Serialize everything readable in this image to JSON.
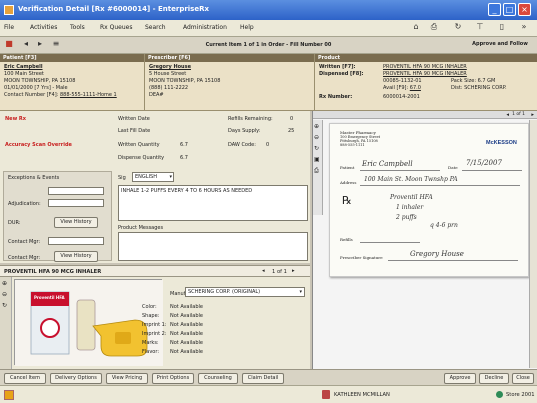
{
  "window": {
    "title": "Verification Detail [Rx #6000014] - EnterpriseRx"
  },
  "menu": [
    "File",
    "Activities",
    "Tools",
    "Rx Queues",
    "Search",
    "Administration",
    "Help"
  ],
  "navbar": {
    "current_item": "Current Item 1 of 1 in Order - Fill Number 00",
    "approve_label": "Approve and Follow"
  },
  "patient": {
    "title": "Patient [F3]",
    "name": "Eric Campbell",
    "address1": "100 Main Street",
    "address2": "MOON TOWNSHIP, PA 15108",
    "dob_line": "01/01/2000 [7 Yrs] - Male",
    "contact_label": "Contact Number [F4]:",
    "contact_value": "888-555-1111-Home 1"
  },
  "prescriber": {
    "title": "Prescriber [F6]",
    "name": "Gregory House",
    "address1": "5 House Street",
    "address2": "MOON TOWNSHIP, PA 15108",
    "phone": "(888) 111-2222",
    "dea": "DEA#"
  },
  "product": {
    "title": "Product",
    "written_label": "Written [F7]:",
    "written_value": "PROVENTIL HFA 90 MCG INHALER",
    "dispensed_label": "Dispensed [F8]:",
    "dispensed_value": "PROVENTIL HFA 90 MCG INHALER",
    "ndc": "00085-1132-01",
    "pack_size": "Pack Size: 6.7 GM",
    "avail_label": "Avail [F9]:",
    "avail_value": "67.0",
    "dist": "Dist: SCHERING CORP.",
    "rx_number_label": "Rx Number:",
    "rx_number_value": "6000014-2001"
  },
  "fill": {
    "new_rx": "New Rx",
    "accuracy_scan": "Accuracy Scan Override",
    "written_date_label": "Written Date",
    "last_fill_label": "Last Fill Date",
    "written_qty_label": "Written Quantity",
    "written_qty_value": "6.7",
    "dispense_qty_label": "Dispense Quantity",
    "dispense_qty_value": "6.7",
    "refills_label": "Refills Remaining:",
    "refills_value": "0",
    "days_supply_label": "Days Supply:",
    "days_supply_value": "25",
    "daw_label": "DAW Code:",
    "daw_value": "0"
  },
  "exceptions": {
    "title": "Exceptions & Events",
    "adjudication": "Adjudication:",
    "dur": "DUR:",
    "view_history": "View History",
    "contact_mgr": "Contact Mgr:"
  },
  "sig": {
    "label": "Sig",
    "language": "ENGLISH",
    "text": "INHALE 1-2 PUFFS EVERY 4 TO 6 HOURS AS NEEDED"
  },
  "product_messages": {
    "title": "Product Messages"
  },
  "image_viewer": {
    "page": "1 of 1"
  },
  "scan": {
    "pharmacy": "Master Pharmacy",
    "pharmacy_addr1": "100 Emergency Street",
    "pharmacy_addr2": "Pittsburgh, PA 15108",
    "pharmacy_phone": "888-555-1111",
    "logo": "McKESSON",
    "patient_label": "Patient",
    "patient_hw": "Eric Campbell",
    "date_label": "Date",
    "date_hw": "7/15/2007",
    "address_label": "Address",
    "address_hw": "100 Main St. Moon Twnshp PA",
    "rx_symbol": "℞",
    "rx_line1": "Proventil HFA",
    "rx_line2": "1 inhaler",
    "rx_line3": "2 puffs",
    "rx_line4": "q 4-6 prn",
    "refills_label": "Refills",
    "prescriber_label": "Prescriber Signature",
    "prescriber_hw": "Gregory House"
  },
  "drug_panel": {
    "title": "PROVENTIL HFA 90 MCG INHALER",
    "page": "1 of 1",
    "manufacturer_label": "Manufacturer:",
    "manufacturer_value": "SCHERING CORP. (ORIGINAL)",
    "rows": [
      {
        "label": "Color:",
        "value": "Not Available"
      },
      {
        "label": "Shape:",
        "value": "Not Available"
      },
      {
        "label": "Imprint 1:",
        "value": "Not Available"
      },
      {
        "label": "Imprint 2:",
        "value": "Not Available"
      },
      {
        "label": "Marks:",
        "value": "Not Available"
      },
      {
        "label": "Flavor:",
        "value": "Not Available"
      }
    ],
    "box_brand": "Proventil HFA"
  },
  "bottom_buttons": [
    "Cancel Item",
    "Delivery Options",
    "View Pricing",
    "Print Options",
    "Counseling",
    "Claim Detail"
  ],
  "right_buttons": [
    "Approve",
    "Decline",
    "Close"
  ],
  "status": {
    "user": "KATHLEEN MCMILLAN",
    "store": "Store 2001"
  }
}
